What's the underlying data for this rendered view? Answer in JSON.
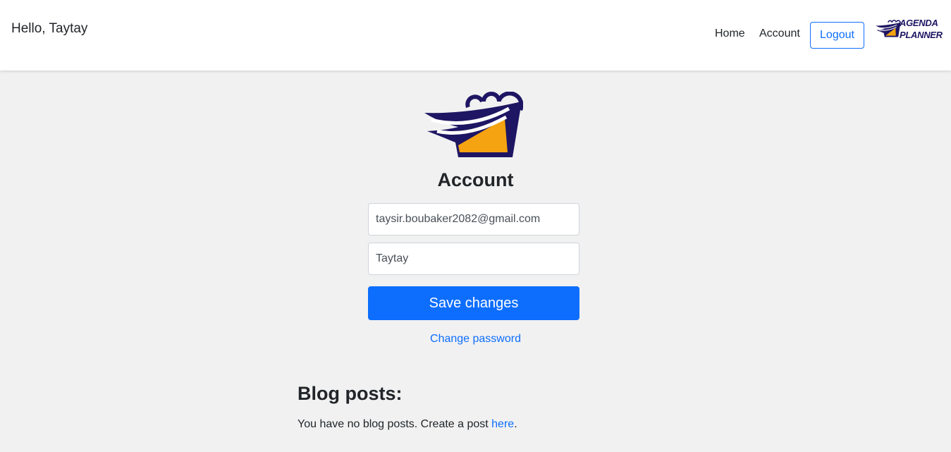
{
  "header": {
    "greeting": "Hello, Taytay",
    "nav": {
      "home": "Home",
      "account": "Account"
    },
    "logout_label": "Logout",
    "brand": {
      "line1": "AGENDA",
      "line2": "PLANNER"
    }
  },
  "main": {
    "title": "Account",
    "email_value": "taysir.boubaker2082@gmail.com",
    "name_value": "Taytay",
    "save_label": "Save changes",
    "change_password_label": "Change password"
  },
  "blog": {
    "heading": "Blog posts:",
    "empty_text": "You have no blog posts. Create a post ",
    "link_label": "here",
    "trailing": "."
  },
  "colors": {
    "primary": "#0d6efd",
    "brand_navy": "#1e1663",
    "brand_orange": "#f5a310",
    "background": "#f1f1f1"
  },
  "icons": {
    "brand_logo": "agenda-planner-logo-icon",
    "main_logo": "calendar-planner-logo-icon"
  }
}
